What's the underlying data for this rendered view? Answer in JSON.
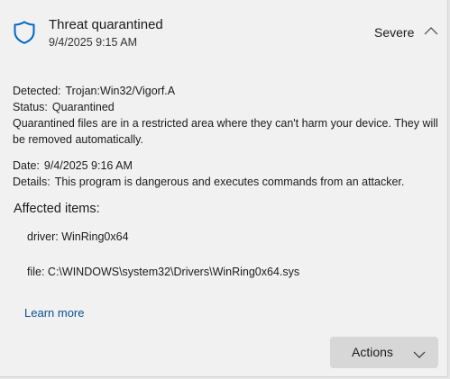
{
  "header": {
    "title": "Threat quarantined",
    "timestamp": "9/4/2025 9:15 AM",
    "severity": "Severe",
    "icon": "shield-icon",
    "collapse_icon": "chevron-up-icon"
  },
  "details": {
    "detected_label": "Detected:",
    "detected_value": "Trojan:Win32/Vigorf.A",
    "status_label": "Status:",
    "status_value": "Quarantined",
    "status_note": "Quarantined files are in a restricted area where they can't harm your device. They will be removed automatically.",
    "date_label": "Date:",
    "date_value": "9/4/2025 9:16 AM",
    "details_label": "Details:",
    "details_value": "This program is dangerous and executes commands from an attacker."
  },
  "affected": {
    "title": "Affected items:",
    "items": [
      "driver: WinRing0x64",
      "file: C:\\WINDOWS\\system32\\Drivers\\WinRing0x64.sys"
    ]
  },
  "links": {
    "learn_more": "Learn more"
  },
  "actions": {
    "label": "Actions",
    "icon": "chevron-down-icon"
  },
  "colors": {
    "panel_bg": "#f1f1f1",
    "accent": "#0067c0",
    "link": "#0a4f95",
    "button_bg": "#d7d7d7"
  }
}
